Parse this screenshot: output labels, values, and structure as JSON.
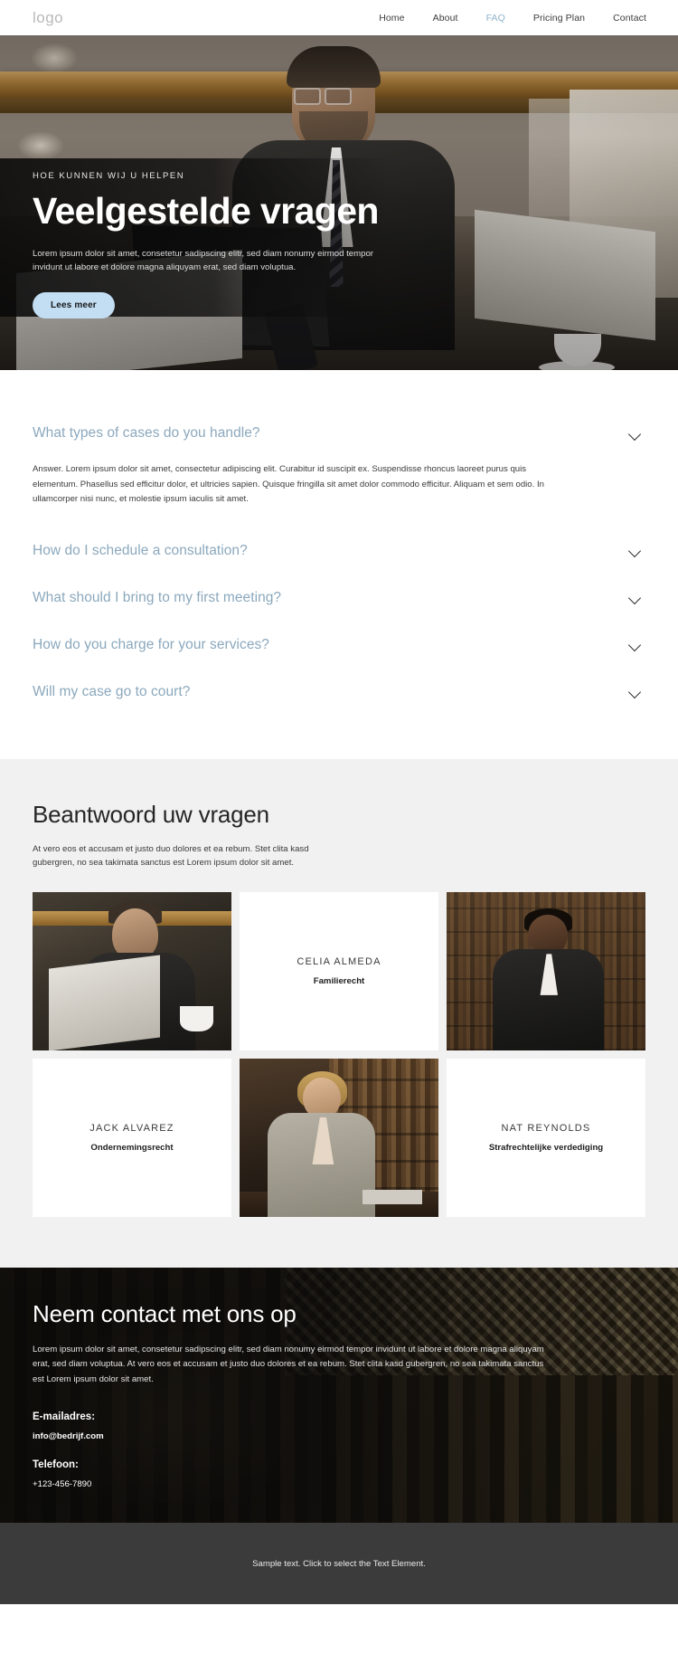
{
  "header": {
    "logo": "logo",
    "nav": [
      {
        "label": "Home",
        "active": false
      },
      {
        "label": "About",
        "active": false
      },
      {
        "label": "FAQ",
        "active": true
      },
      {
        "label": "Pricing Plan",
        "active": false
      },
      {
        "label": "Contact",
        "active": false
      }
    ]
  },
  "hero": {
    "eyebrow": "HOE KUNNEN WIJ U HELPEN",
    "title": "Veelgestelde vragen",
    "subtitle": "Lorem ipsum dolor sit amet, consetetur sadipscing elitr, sed diam nonumy eirmod tempor invidunt ut labore et dolore magna aliquyam erat, sed diam voluptua.",
    "button": "Lees meer",
    "button_color": "#c3ddf2"
  },
  "faq": {
    "accent_color": "#8ba8bd",
    "open_item": {
      "question": "What types of cases do you handle?",
      "answer": "Answer. Lorem ipsum dolor sit amet, consectetur adipiscing elit. Curabitur id suscipit ex. Suspendisse rhoncus laoreet purus quis elementum. Phasellus sed efficitur dolor, et ultricies sapien. Quisque fringilla sit amet dolor commodo efficitur. Aliquam et sem odio. In ullamcorper nisi nunc, et molestie ipsum iaculis sit amet.",
      "icon": "chevron-down-icon"
    },
    "items": [
      {
        "question": "How do I schedule a consultation?",
        "icon": "chevron-down-icon"
      },
      {
        "question": "What should I bring to my first meeting?",
        "icon": "chevron-down-icon"
      },
      {
        "question": "How do you charge for your services?",
        "icon": "chevron-down-icon"
      },
      {
        "question": "Will my case go to court?",
        "icon": "chevron-down-icon"
      }
    ]
  },
  "team": {
    "title": "Beantwoord uw vragen",
    "subtitle": "At vero eos et accusam et justo duo dolores et ea rebum. Stet clita kasd gubergren, no sea takimata sanctus est Lorem ipsum dolor sit amet.",
    "members": [
      {
        "name": "CELIA ALMEDA",
        "role": "Familierecht"
      },
      {
        "name": "JACK ALVAREZ",
        "role": "Ondernemingsrecht"
      },
      {
        "name": "NAT REYNOLDS",
        "role": "Strafrechtelijke verdediging"
      }
    ]
  },
  "contact": {
    "title": "Neem contact met ons op",
    "body": "Lorem ipsum dolor sit amet, consetetur sadipscing elitr, sed diam nonumy eirmod tempor invidunt ut labore et dolore magna aliquyam erat, sed diam voluptua. At vero eos et accusam et justo duo dolores et ea rebum. Stet clita kasd gubergren, no sea takimata sanctus est Lorem ipsum dolor sit amet.",
    "email_label": "E-mailadres:",
    "email_value": "info@bedrijf.com",
    "phone_label": "Telefoon:",
    "phone_value": "+123-456-7890"
  },
  "footer": {
    "text": "Sample text. Click to select the Text Element."
  }
}
